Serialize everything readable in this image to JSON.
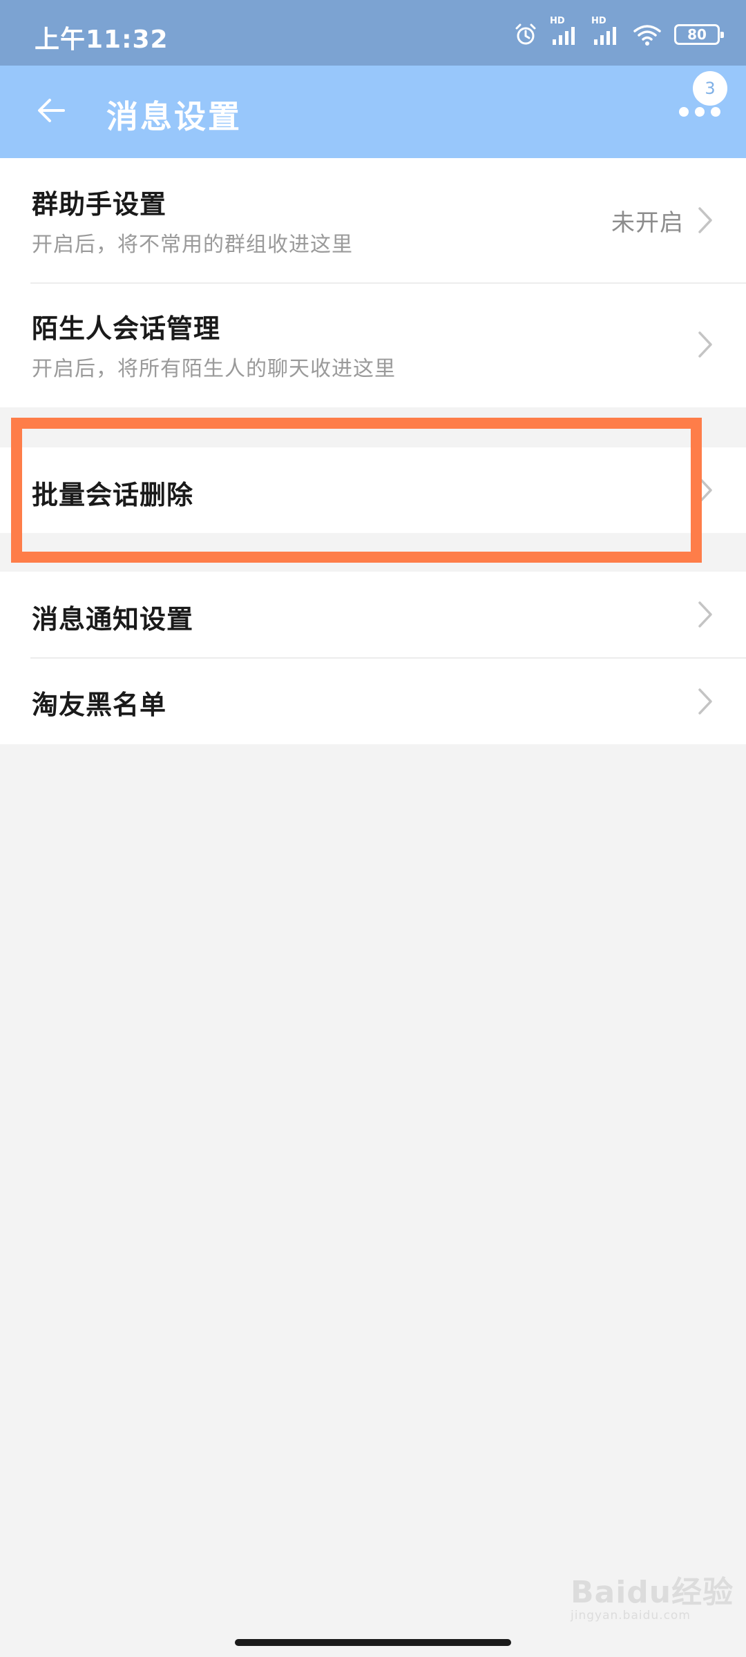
{
  "status_bar": {
    "time": "上午11:32",
    "signal1_label": "HD",
    "signal2_label": "HD",
    "battery": "80",
    "icons": [
      "alarm-icon",
      "signal-icon",
      "signal-icon",
      "wifi-icon",
      "battery-icon"
    ]
  },
  "header": {
    "title": "消息设置",
    "back_icon": "arrow-left-icon",
    "more_icon": "more-dots-icon",
    "badge_count": "3",
    "background": "#98c7fb"
  },
  "settings": {
    "group_assistant": {
      "title": "群助手设置",
      "subtitle": "开启后，将不常用的群组收进这里",
      "value": "未开启"
    },
    "stranger": {
      "title": "陌生人会话管理",
      "subtitle": "开启后，将所有陌生人的聊天收进这里"
    },
    "batch_delete": {
      "title": "批量会话删除"
    },
    "notification": {
      "title": "消息通知设置"
    },
    "blacklist": {
      "title": "淘友黑名单"
    }
  },
  "highlight": {
    "color": "#fe7d49",
    "target": "batch_delete"
  },
  "watermark": {
    "logo": "Baidu经验",
    "sub": "jingyan.baidu.com"
  }
}
